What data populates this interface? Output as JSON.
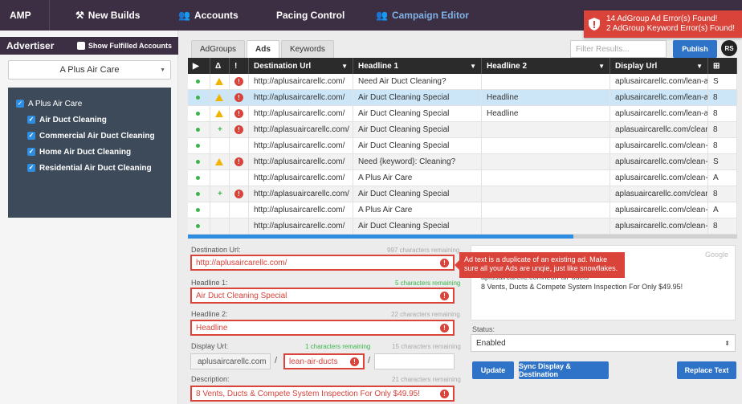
{
  "nav": {
    "brand": "AMP",
    "items": [
      {
        "label": "New Builds",
        "icon": "tools-icon"
      },
      {
        "label": "Accounts",
        "icon": "users-icon"
      },
      {
        "label": "Pacing Control",
        "icon": ""
      },
      {
        "label": "Campaign Editor",
        "icon": "users-icon"
      }
    ]
  },
  "toast": {
    "line1": "14 AdGroup Ad Error(s) Found!",
    "line2": "2 AdGroup Keyword Error(s) Found!"
  },
  "sidebar": {
    "title": "Advertiser",
    "show_fulfilled": "Show Fulfilled Accounts",
    "selected_advertiser": "A Plus Air Care",
    "tree": {
      "root": "A Plus Air Care",
      "children": [
        "Air Duct Cleaning",
        "Commercial Air Duct Cleaning",
        "Home Air Duct Cleaning",
        "Residential Air Duct Cleaning"
      ]
    }
  },
  "tabs": [
    "AdGroups",
    "Ads",
    "Keywords"
  ],
  "filter_placeholder": "Filter Results...",
  "publish_label": "Publish",
  "user_initials": "RS",
  "table": {
    "headers": [
      "▶",
      "Δ",
      "!",
      "Destination Url",
      "Headline 1",
      "Headline 2",
      "Display Url",
      "⊞"
    ],
    "rows": [
      {
        "status": "dot",
        "delta": "warn",
        "err": true,
        "dest": "http://aplusaircarellc.com/",
        "h1": "Need Air Duct Cleaning?",
        "h2": "",
        "display": "aplusaircarellc.com/lean-air-d...",
        "last": "S"
      },
      {
        "status": "dot",
        "delta": "warn",
        "err": true,
        "dest": "http://aplusaircarellc.com/",
        "h1": "Air Duct Cleaning Special",
        "h2": "Headline",
        "display": "aplusaircarellc.com/lean-air-d...",
        "last": "8"
      },
      {
        "status": "dot",
        "delta": "warn",
        "err": true,
        "dest": "http://aplusaircarellc.com/",
        "h1": "Air Duct Cleaning Special",
        "h2": "Headline",
        "display": "aplusaircarellc.com/lean-air-d...",
        "last": "8"
      },
      {
        "status": "dot",
        "delta": "plus",
        "err": true,
        "dest": "http://aplasuaircarellc.com/",
        "h1": "Air Duct Cleaning Special",
        "h2": "",
        "display": "aplasuaircarellc.com/clean-air...",
        "last": "8"
      },
      {
        "status": "dot",
        "delta": "",
        "err": false,
        "dest": "http://aplusaircarellc.com/",
        "h1": "Air Duct Cleaning Special",
        "h2": "",
        "display": "aplusaircarellc.com/clean-air-...",
        "last": "8"
      },
      {
        "status": "dot",
        "delta": "warn",
        "err": true,
        "dest": "http://aplusaircarellc.com/",
        "h1": "Need {keyword}: Cleaning?",
        "h2": "",
        "display": "aplusaircarellc.com/clean-air-...",
        "last": "S"
      },
      {
        "status": "dot",
        "delta": "",
        "err": false,
        "dest": "http://aplusaircarellc.com/",
        "h1": "A Plus Air Care",
        "h2": "",
        "display": "aplusaircarellc.com/clean-air-...",
        "last": "A"
      },
      {
        "status": "dot",
        "delta": "plus",
        "err": true,
        "dest": "http://aplasuaircarellc.com/",
        "h1": "Air Duct Cleaning Special",
        "h2": "",
        "display": "aplasuaircarellc.com/clean-air...",
        "last": "8"
      },
      {
        "status": "dot",
        "delta": "",
        "err": false,
        "dest": "http://aplusaircarellc.com/",
        "h1": "A Plus Air Care",
        "h2": "",
        "display": "aplusaircarellc.com/clean-air-...",
        "last": "A"
      },
      {
        "status": "dot",
        "delta": "",
        "err": false,
        "dest": "http://aplusaircarellc.com/",
        "h1": "Air Duct Cleaning Special",
        "h2": "",
        "display": "aplusaircarellc.com/clean-air-...",
        "last": "8"
      }
    ]
  },
  "form": {
    "dest_label": "Destination Url:",
    "dest_count": "997 characters remaining",
    "dest_value": "http://aplusaircarellc.com/",
    "h1_label": "Headline 1:",
    "h1_count": "5 characters remaining",
    "h1_value": "Air Duct Cleaning Special",
    "h2_label": "Headline 2:",
    "h2_count": "22 characters remaining",
    "h2_value": "Headline",
    "disp_label": "Display Url:",
    "disp_count1": "1 characters remaining",
    "disp_count2": "15 characters remaining",
    "disp_base": "aplusaircarellc.com",
    "disp_path1": "lean-air-ducts",
    "disp_path2": "",
    "desc_label": "Description:",
    "desc_count": "21 characters remaining",
    "desc_value": "8 Vents, Ducts & Compete System Inspection For Only $49.95!"
  },
  "tooltip": "Ad text is a duplicate of an existing ad. Make sure all your Ads are unqie, just like snowflakes.",
  "preview": {
    "google": "Google",
    "url": "aplusaircarellc.com/lean-air-ducts",
    "desc": "8 Vents, Ducts & Compete System Inspection For Only $49.95!"
  },
  "status": {
    "label": "Status:",
    "value": "Enabled"
  },
  "buttons": {
    "update": "Update",
    "sync": "Sync Display & Destination",
    "replace": "Replace Text"
  }
}
